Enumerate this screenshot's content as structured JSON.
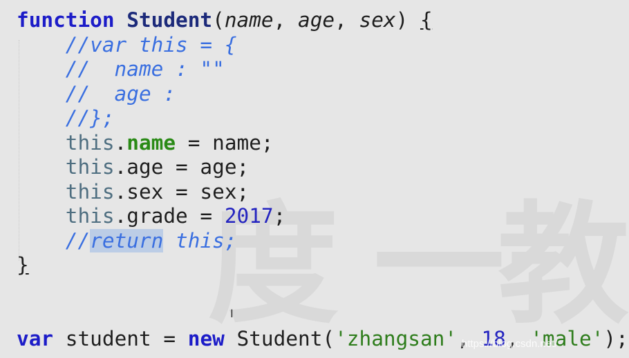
{
  "editor": {
    "lines": [
      {
        "tokens": [
          "function",
          " ",
          "Student",
          "(",
          "name",
          ", ",
          "age",
          ", ",
          "sex",
          ") ",
          "{"
        ]
      },
      {
        "tokens": [
          "    ",
          "//var this = {"
        ]
      },
      {
        "tokens": [
          "    ",
          "//  name : \"\""
        ]
      },
      {
        "tokens": [
          "    ",
          "//  age :"
        ]
      },
      {
        "tokens": [
          "    ",
          "//};"
        ]
      },
      {
        "tokens": [
          "    ",
          "this",
          ".",
          "name",
          " = name;"
        ]
      },
      {
        "tokens": [
          "    ",
          "this",
          ".age = age;"
        ]
      },
      {
        "tokens": [
          "    ",
          "this",
          ".sex = sex;"
        ]
      },
      {
        "tokens": [
          "    ",
          "this",
          ".grade = ",
          "2017",
          ";"
        ]
      },
      {
        "tokens": [
          "    ",
          "//",
          "return",
          " this;"
        ]
      },
      {
        "tokens": [
          "}"
        ]
      },
      {
        "tokens": [
          ""
        ]
      },
      {
        "tokens": [
          ""
        ]
      },
      {
        "tokens": [
          "var",
          " student = ",
          "new",
          " Student(",
          "'zhangsan'",
          ", ",
          "18",
          ", ",
          "'male'",
          ");"
        ]
      }
    ]
  },
  "watermark": {
    "text": "度一教",
    "url": "https://blog.csdn.net/"
  },
  "cursor_icon": "text-cursor-icon",
  "colors": {
    "background": "#e6e6e6",
    "keyword": "#1c1cc8",
    "comment": "#3a6fe0",
    "string": "#2e7d1c",
    "number": "#2424c0",
    "selection": "#bccde6"
  }
}
